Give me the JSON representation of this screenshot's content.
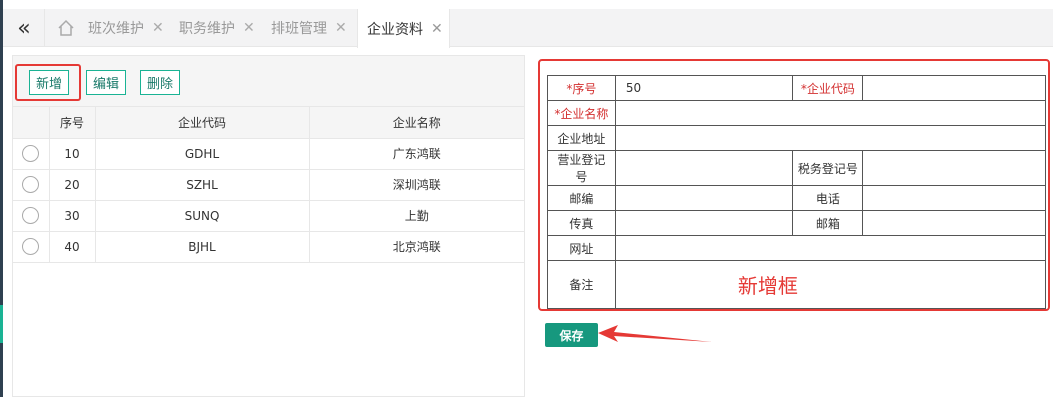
{
  "tabs": {
    "items": [
      {
        "label": "班次维护"
      },
      {
        "label": "职务维护"
      },
      {
        "label": "排班管理"
      }
    ],
    "active": {
      "label": "企业资料"
    },
    "close_glyph": "✕",
    "collapse_glyph": "«"
  },
  "toolbar": {
    "add_label": "新增",
    "edit_label": "编辑",
    "delete_label": "删除"
  },
  "grid": {
    "columns": [
      "",
      "序号",
      "企业代码",
      "企业名称"
    ],
    "rows": [
      {
        "no": "10",
        "code": "GDHL",
        "name": "广东鸿联"
      },
      {
        "no": "20",
        "code": "SZHL",
        "name": "深圳鸿联"
      },
      {
        "no": "30",
        "code": "SUNQ",
        "name": "上勤"
      },
      {
        "no": "40",
        "code": "BJHL",
        "name": "北京鸿联"
      }
    ]
  },
  "form": {
    "seq_label": "*序号",
    "seq_value": "50",
    "code_label": "*企业代码",
    "code_value": "",
    "name_label": "*企业名称",
    "name_value": "",
    "address_label": "企业地址",
    "address_value": "",
    "biz_reg_label": "营业登记号",
    "tax_reg_label": "税务登记号",
    "postcode_label": "邮编",
    "phone_label": "电话",
    "fax_label": "传真",
    "email_label": "邮箱",
    "website_label": "网址",
    "remark_label": "备注",
    "annotation": "新增框"
  },
  "save_label": "保存",
  "colors": {
    "accent": "#1ab394",
    "save_button": "#16987e",
    "annotation_red": "#e53935"
  },
  "icons": {
    "collapse": "double-chevron-left-icon",
    "home": "home-icon",
    "close": "close-icon",
    "radio": "radio-icon",
    "arrow": "arrow-annotation-icon"
  }
}
